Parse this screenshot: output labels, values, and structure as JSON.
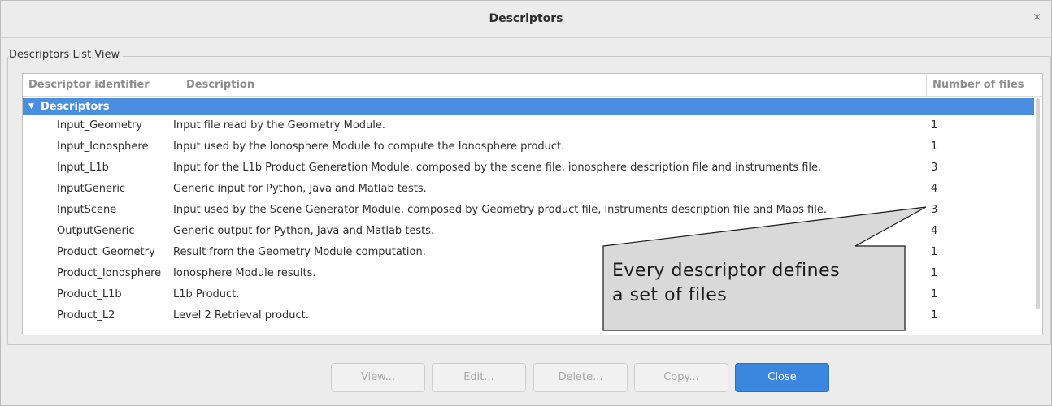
{
  "window": {
    "title": "Descriptors",
    "close_glyph": "×"
  },
  "group": {
    "label": "Descriptors List View"
  },
  "table": {
    "headers": {
      "id": "Descriptor identifier",
      "description": "Description",
      "files": "Number of files"
    },
    "group_row": {
      "arrow": "▼",
      "label": "Descriptors",
      "highlight_color": "#4a8ee0"
    },
    "rows": [
      {
        "id": "Input_Geometry",
        "description": "Input file read by the Geometry Module.",
        "files": "1"
      },
      {
        "id": "Input_Ionosphere",
        "description": "Input used by the Ionosphere Module to compute the Ionosphere product.",
        "files": "1"
      },
      {
        "id": "Input_L1b",
        "description": "Input for the L1b Product Generation Module, composed by the scene file, ionosphere description file and instruments file.",
        "files": "3"
      },
      {
        "id": "InputGeneric",
        "description": "Generic input for Python, Java and Matlab tests.",
        "files": "4"
      },
      {
        "id": "InputScene",
        "description": "Input used by the Scene Generator Module, composed by Geometry product file, instruments description file and Maps file.",
        "files": "3"
      },
      {
        "id": "OutputGeneric",
        "description": "Generic output for Python, Java and Matlab tests.",
        "files": "4"
      },
      {
        "id": "Product_Geometry",
        "description": "Result from the Geometry Module computation.",
        "files": "1"
      },
      {
        "id": "Product_Ionosphere",
        "description": "Ionosphere Module results.",
        "files": "1"
      },
      {
        "id": "Product_L1b",
        "description": "L1b Product.",
        "files": "1"
      },
      {
        "id": "Product_L2",
        "description": "Level 2 Retrieval product.",
        "files": "1"
      }
    ]
  },
  "callout": {
    "line1": "Every descriptor defines",
    "line2": "a set of files"
  },
  "buttons": {
    "view": "View...",
    "edit": "Edit...",
    "delete": "Delete...",
    "copy": "Copy...",
    "close": "Close"
  },
  "colors": {
    "primary": "#3b86df",
    "selection": "#4a8ee0"
  }
}
